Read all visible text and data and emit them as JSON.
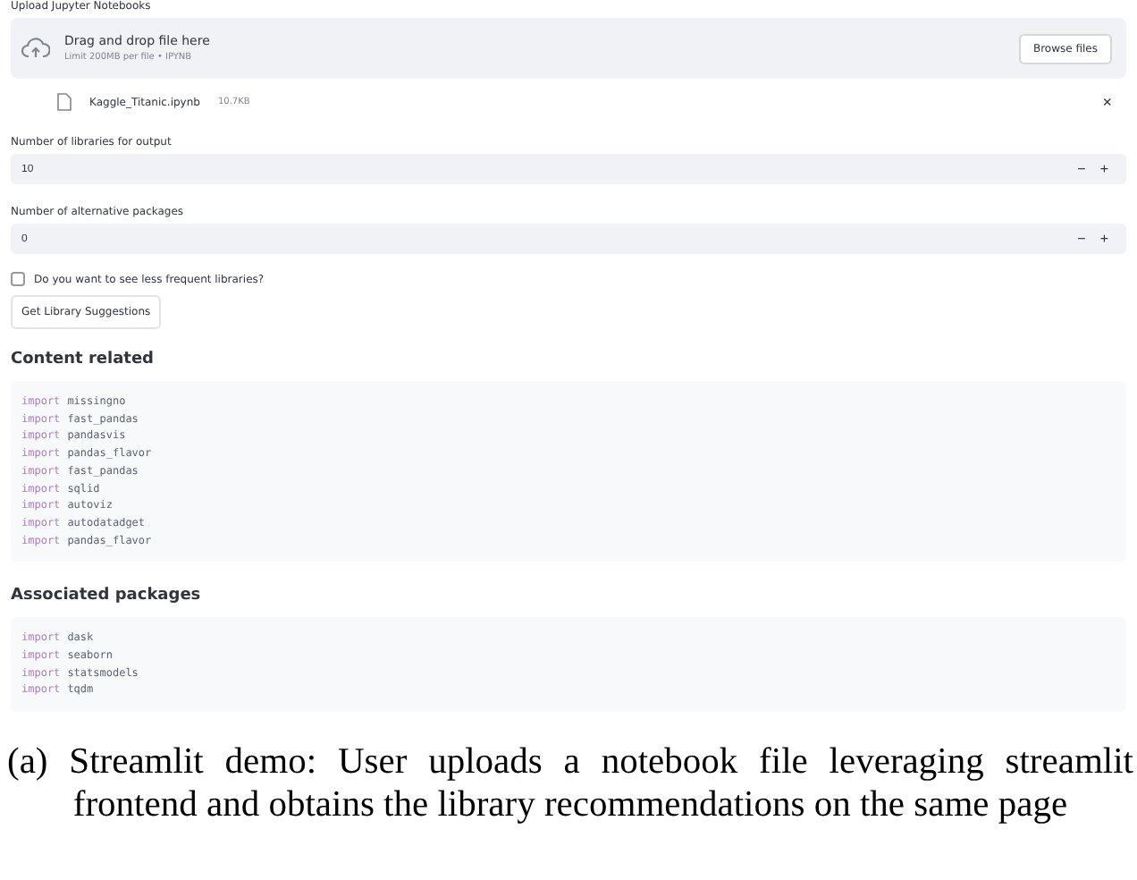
{
  "upload": {
    "label": "Upload Jupyter Notebooks",
    "drop_text": "Drag and drop file here",
    "limit_text": "Limit 200MB per file • IPYNB",
    "browse_button": "Browse files"
  },
  "file": {
    "name": "Kaggle_Titanic.ipynb",
    "size": "10.7KB",
    "remove": "×"
  },
  "number_inputs": [
    {
      "label": "Number of libraries for output",
      "value": "10",
      "minus": "−",
      "plus": "+"
    },
    {
      "label": "Number of alternative packages",
      "value": "0",
      "minus": "−",
      "plus": "+"
    }
  ],
  "checkbox": {
    "label": "Do you want to see less frequent libraries?",
    "checked": false
  },
  "button": "Get Library Suggestions",
  "sections": [
    {
      "heading": "Content related",
      "lines": [
        {
          "keyword": "import",
          "module": "missingno"
        },
        {
          "keyword": "import",
          "module": "fast_pandas"
        },
        {
          "keyword": "import",
          "module": "pandasvis"
        },
        {
          "keyword": "import",
          "module": "pandas_flavor"
        },
        {
          "keyword": "import",
          "module": "fast_pandas"
        },
        {
          "keyword": "import",
          "module": "sqlid"
        },
        {
          "keyword": "import",
          "module": "autoviz"
        },
        {
          "keyword": "import",
          "module": "autodatadget"
        },
        {
          "keyword": "import",
          "module": "pandas_flavor"
        }
      ]
    },
    {
      "heading": "Associated packages",
      "lines": [
        {
          "keyword": "import",
          "module": "dask"
        },
        {
          "keyword": "import",
          "module": "seaborn"
        },
        {
          "keyword": "import",
          "module": "statsmodels"
        },
        {
          "keyword": "import",
          "module": "tqdm"
        }
      ]
    }
  ],
  "caption": "(a) Streamlit demo: User uploads a notebook file leveraging streamlit frontend and obtains the library recommendations on the same page"
}
